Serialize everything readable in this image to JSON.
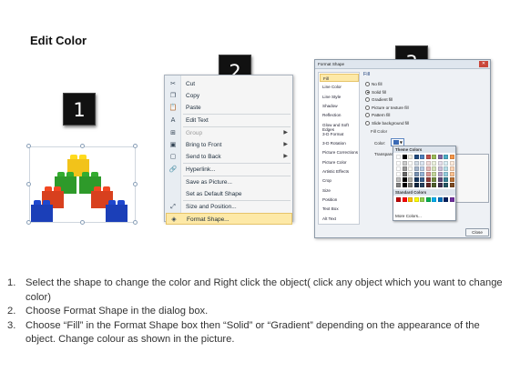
{
  "title": "Edit Color",
  "steps": [
    "1",
    "2",
    "3"
  ],
  "context_menu": {
    "items": [
      {
        "label": "Cut",
        "icon": "cut-icon",
        "glyph": "✂",
        "enabled": true
      },
      {
        "label": "Copy",
        "icon": "copy-icon",
        "glyph": "❐",
        "enabled": true
      },
      {
        "label": "Paste",
        "icon": "paste-icon",
        "glyph": "📋",
        "enabled": true
      },
      {
        "label": "Edit Text",
        "icon": "edit-text-icon",
        "glyph": "A",
        "enabled": true
      },
      {
        "label": "Group",
        "icon": "group-icon",
        "glyph": "⊞",
        "enabled": false,
        "submenu": true
      },
      {
        "label": "Bring to Front",
        "icon": "bring-to-front-icon",
        "glyph": "▣",
        "enabled": true,
        "submenu": true
      },
      {
        "label": "Send to Back",
        "icon": "send-to-back-icon",
        "glyph": "▢",
        "enabled": true,
        "submenu": true
      },
      {
        "label": "Hyperlink...",
        "icon": "hyperlink-icon",
        "glyph": "🔗",
        "enabled": true
      },
      {
        "label": "Save as Picture...",
        "icon": "",
        "glyph": "",
        "enabled": true
      },
      {
        "label": "Set as Default Shape",
        "icon": "",
        "glyph": "",
        "enabled": true
      },
      {
        "label": "Size and Position...",
        "icon": "size-position-icon",
        "glyph": "⤢",
        "enabled": true
      },
      {
        "label": "Format Shape...",
        "icon": "format-shape-icon",
        "glyph": "◈",
        "enabled": true,
        "highlighted": true
      }
    ]
  },
  "dialog": {
    "title": "Format Shape",
    "close_glyph": "✕",
    "nav_items": [
      "Fill",
      "Line Color",
      "Line Style",
      "Shadow",
      "Reflection",
      "Glow and Soft Edges",
      "3-D Format",
      "3-D Rotation",
      "Picture Corrections",
      "Picture Color",
      "Artistic Effects",
      "Crop",
      "Size",
      "Position",
      "Text Box",
      "Alt Text"
    ],
    "selected_nav": "Fill",
    "fill_heading": "Fill",
    "fill_options": [
      "No fill",
      "Solid fill",
      "Gradient fill",
      "Picture or texture fill",
      "Pattern fill",
      "Slide background fill"
    ],
    "fill_selected": "Solid fill",
    "fill_color_label": "Fill Color",
    "color_label": "Color:",
    "transparency_label": "Transparency:",
    "palette": {
      "theme_heading": "Theme Colors",
      "theme_colors": [
        "#ffffff",
        "#000000",
        "#eeece1",
        "#1f497d",
        "#4f81bd",
        "#c0504d",
        "#9bbb59",
        "#8064a2",
        "#4bacc6",
        "#f79646"
      ],
      "standard_heading": "Standard Colors",
      "standard_colors": [
        "#c00000",
        "#ff0000",
        "#ffc000",
        "#ffff00",
        "#92d050",
        "#00b050",
        "#00b0f0",
        "#0070c0",
        "#002060",
        "#7030a0"
      ],
      "more_label": "More Colors..."
    },
    "close_label": "Close"
  },
  "instructions": [
    {
      "num": "1.",
      "text": "Select the shape to change the color and Right click the object( click any object which you want to change color)"
    },
    {
      "num": "2.",
      "text": "Choose Format Shape in the dialog box."
    },
    {
      "num": "3.",
      "text": "Choose “Fill” in the Format Shape box then “Solid” or “Gradient” depending on the appearance of the object. Change colour as shown in the picture."
    }
  ]
}
